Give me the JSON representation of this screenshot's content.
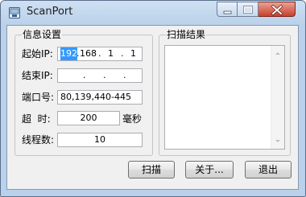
{
  "window": {
    "title": "ScanPort",
    "controls": {
      "minimize_icon": "minimize-icon",
      "maximize_icon": "maximize-icon",
      "close_icon": "close-icon"
    }
  },
  "settings": {
    "group_label": "信息设置",
    "start_ip": {
      "label": "起始IP:",
      "octets": [
        "192",
        "168",
        "1",
        "1"
      ],
      "selected_octet": 0
    },
    "end_ip": {
      "label": "结束IP:",
      "octets": [
        "",
        "",
        "",
        ""
      ]
    },
    "ports": {
      "label": "端口号:",
      "value": "80,139,440-445"
    },
    "timeout": {
      "label": "超  时:",
      "value": "200",
      "unit": "毫秒"
    },
    "threads": {
      "label": "线程数:",
      "value": "10"
    }
  },
  "results": {
    "group_label": "扫描结果",
    "items": []
  },
  "buttons": {
    "scan": "扫描",
    "about": "关于...",
    "exit": "退出"
  },
  "colors": {
    "frame": "#b9d1ea",
    "close": "#c7402c",
    "selection": "#3399ff",
    "dialog": "#f0f0f0"
  }
}
